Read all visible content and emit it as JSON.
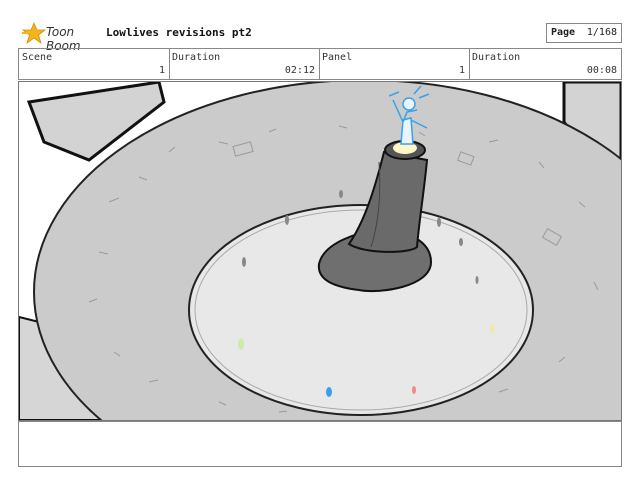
{
  "header": {
    "brand": "Toon Boom",
    "title": "Lowlives revisions pt2",
    "page_label": "Page",
    "page_value": "1/168"
  },
  "info": {
    "scene_label": "Scene",
    "scene_value": "1",
    "duration_label": "Duration",
    "duration_value": "02:12",
    "panel_label": "Panel",
    "panel_value": "1",
    "panel_duration_label": "Duration",
    "panel_duration_value": "00:08"
  },
  "colors": {
    "brand_star": "#f2b51c",
    "figure_blue": "#3aa0e8",
    "floor": "#c9c9c9",
    "inner_floor": "#e6e6e6",
    "tower": "#6f6f6f"
  },
  "notes": {
    "text": ""
  }
}
